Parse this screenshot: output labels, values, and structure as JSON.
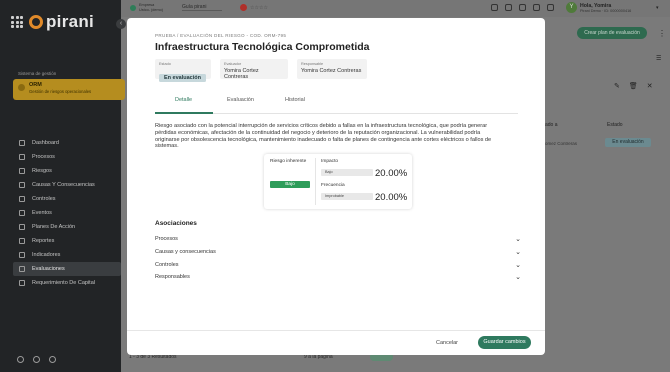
{
  "app": {
    "logo_text": "pirani"
  },
  "topbar": {
    "company_line1": "Empresa",
    "company_line2": "Ustco- (demo)",
    "company_select": "Guía pirani",
    "user_initial": "Y",
    "user_name": "Hola, Yomira",
    "user_org": "Pirani Demo · ID: 0000000416"
  },
  "sidebar": {
    "system_label": "Sistema de gestión",
    "module_title": "ORM",
    "module_subtitle": "Gestión de riesgos operacionales",
    "items": [
      {
        "label": "Dashboard",
        "icon": "dashboard-icon"
      },
      {
        "label": "Procesos",
        "icon": "process-icon"
      },
      {
        "label": "Riesgos",
        "icon": "risk-icon"
      },
      {
        "label": "Causas Y Consecuencias",
        "icon": "cause-icon"
      },
      {
        "label": "Controles",
        "icon": "control-icon"
      },
      {
        "label": "Eventos",
        "icon": "event-icon"
      },
      {
        "label": "Planes De Acción",
        "icon": "plan-icon"
      },
      {
        "label": "Reportes",
        "icon": "report-icon"
      },
      {
        "label": "Indicadores",
        "icon": "indicator-icon"
      },
      {
        "label": "Evaluaciones",
        "icon": "evaluation-icon",
        "active": true
      },
      {
        "label": "Requerimiento De Capital",
        "icon": "capital-icon"
      }
    ]
  },
  "background": {
    "plan_button": "Crear plan de evaluación",
    "col_a": "ado a",
    "col_b": "Estado",
    "row_name": "omez Contreras",
    "row_status": "En evaluación",
    "results": "1 - 3 de 3 Resultados",
    "per_page": "9 a la página"
  },
  "modal": {
    "breadcrumb": "PRUEBA / EVALUACIÓN DEL RIESGO - COD. ORM-795",
    "title": "Infraestructura Tecnológica Comprometida",
    "status_label": "Estado",
    "status_value": "En evaluación",
    "evaluator_label": "Evaluador",
    "evaluator_value": "Yomira Cortez Contreras",
    "responsible_label": "Responsable",
    "responsible_value": "Yomira Cortez Contreras",
    "tabs": [
      "Detalle",
      "Evaluación",
      "Historial"
    ],
    "description": "Riesgo asociado con la potencial interrupción de servicios críticos debido a fallas en la infraestructura tecnológica, que podría generar pérdidas económicas, afectación de la continuidad del negocio y deterioro de la reputación organizacional. La vulnerabilidad podría originarse por obsolescencia tecnológica, mantenimiento inadecuado o falta de planes de contingencia ante cortes eléctricos o fallos de sistemas.",
    "risk": {
      "inherent_label": "Riesgo inherente",
      "inherent_level": "Bajo",
      "inherent_color": "#2e9d5a",
      "impact_label": "Impacto",
      "impact_level": "Bajo",
      "impact_pct": "20.00%",
      "frequency_label": "Frecuencia",
      "frequency_level": "Improbable",
      "frequency_pct": "20.00%"
    },
    "associations_title": "Asociaciones",
    "associations": [
      "Procesos",
      "Causas y consecuencias",
      "Controles",
      "Responsables"
    ],
    "cancel_label": "Cancelar",
    "save_label": "Guardar cambios",
    "accent_color": "#2f7a5f"
  }
}
